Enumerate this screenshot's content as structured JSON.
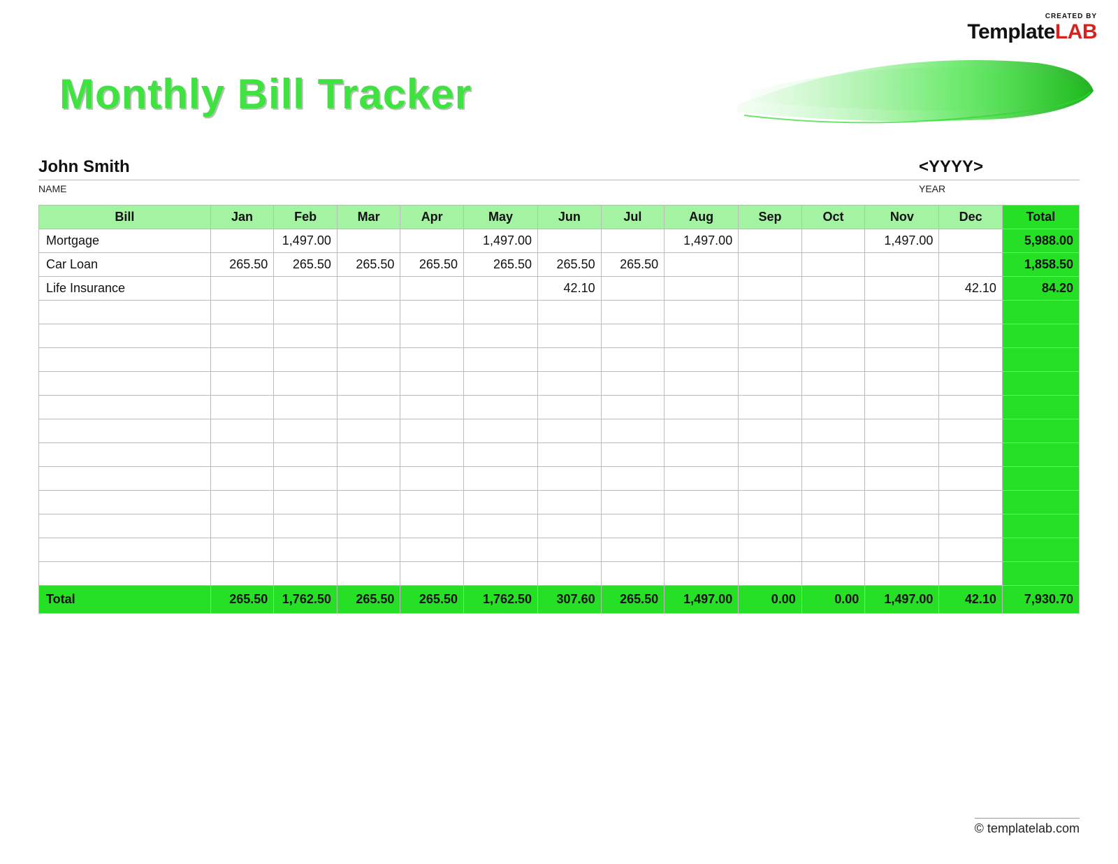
{
  "brand": {
    "created_by": "CREATED BY",
    "name_a": "Template",
    "name_b": "LAB"
  },
  "title": "Monthly Bill Tracker",
  "meta": {
    "name_value": "John Smith",
    "name_label": "NAME",
    "year_value": "<YYYY>",
    "year_label": "YEAR"
  },
  "columns": [
    "Bill",
    "Jan",
    "Feb",
    "Mar",
    "Apr",
    "May",
    "Jun",
    "Jul",
    "Aug",
    "Sep",
    "Oct",
    "Nov",
    "Dec",
    "Total"
  ],
  "rows": [
    {
      "bill": "Mortgage",
      "cells": [
        "",
        "1,497.00",
        "",
        "",
        "1,497.00",
        "",
        "",
        "1,497.00",
        "",
        "",
        "1,497.00",
        ""
      ],
      "total": "5,988.00"
    },
    {
      "bill": "Car Loan",
      "cells": [
        "265.50",
        "265.50",
        "265.50",
        "265.50",
        "265.50",
        "265.50",
        "265.50",
        "",
        "",
        "",
        "",
        ""
      ],
      "total": "1,858.50"
    },
    {
      "bill": "Life Insurance",
      "cells": [
        "",
        "",
        "",
        "",
        "",
        "42.10",
        "",
        "",
        "",
        "",
        "",
        "42.10"
      ],
      "total": "84.20"
    },
    {
      "bill": "",
      "cells": [
        "",
        "",
        "",
        "",
        "",
        "",
        "",
        "",
        "",
        "",
        "",
        ""
      ],
      "total": ""
    },
    {
      "bill": "",
      "cells": [
        "",
        "",
        "",
        "",
        "",
        "",
        "",
        "",
        "",
        "",
        "",
        ""
      ],
      "total": ""
    },
    {
      "bill": "",
      "cells": [
        "",
        "",
        "",
        "",
        "",
        "",
        "",
        "",
        "",
        "",
        "",
        ""
      ],
      "total": ""
    },
    {
      "bill": "",
      "cells": [
        "",
        "",
        "",
        "",
        "",
        "",
        "",
        "",
        "",
        "",
        "",
        ""
      ],
      "total": ""
    },
    {
      "bill": "",
      "cells": [
        "",
        "",
        "",
        "",
        "",
        "",
        "",
        "",
        "",
        "",
        "",
        ""
      ],
      "total": ""
    },
    {
      "bill": "",
      "cells": [
        "",
        "",
        "",
        "",
        "",
        "",
        "",
        "",
        "",
        "",
        "",
        ""
      ],
      "total": ""
    },
    {
      "bill": "",
      "cells": [
        "",
        "",
        "",
        "",
        "",
        "",
        "",
        "",
        "",
        "",
        "",
        ""
      ],
      "total": ""
    },
    {
      "bill": "",
      "cells": [
        "",
        "",
        "",
        "",
        "",
        "",
        "",
        "",
        "",
        "",
        "",
        ""
      ],
      "total": ""
    },
    {
      "bill": "",
      "cells": [
        "",
        "",
        "",
        "",
        "",
        "",
        "",
        "",
        "",
        "",
        "",
        ""
      ],
      "total": ""
    },
    {
      "bill": "",
      "cells": [
        "",
        "",
        "",
        "",
        "",
        "",
        "",
        "",
        "",
        "",
        "",
        ""
      ],
      "total": ""
    },
    {
      "bill": "",
      "cells": [
        "",
        "",
        "",
        "",
        "",
        "",
        "",
        "",
        "",
        "",
        "",
        ""
      ],
      "total": ""
    },
    {
      "bill": "",
      "cells": [
        "",
        "",
        "",
        "",
        "",
        "",
        "",
        "",
        "",
        "",
        "",
        ""
      ],
      "total": ""
    }
  ],
  "footer": {
    "label": "Total",
    "cells": [
      "265.50",
      "1,762.50",
      "265.50",
      "265.50",
      "1,762.50",
      "307.60",
      "265.50",
      "1,497.00",
      "0.00",
      "0.00",
      "1,497.00",
      "42.10"
    ],
    "grand": "7,930.70"
  },
  "copyright": "© templatelab.com"
}
